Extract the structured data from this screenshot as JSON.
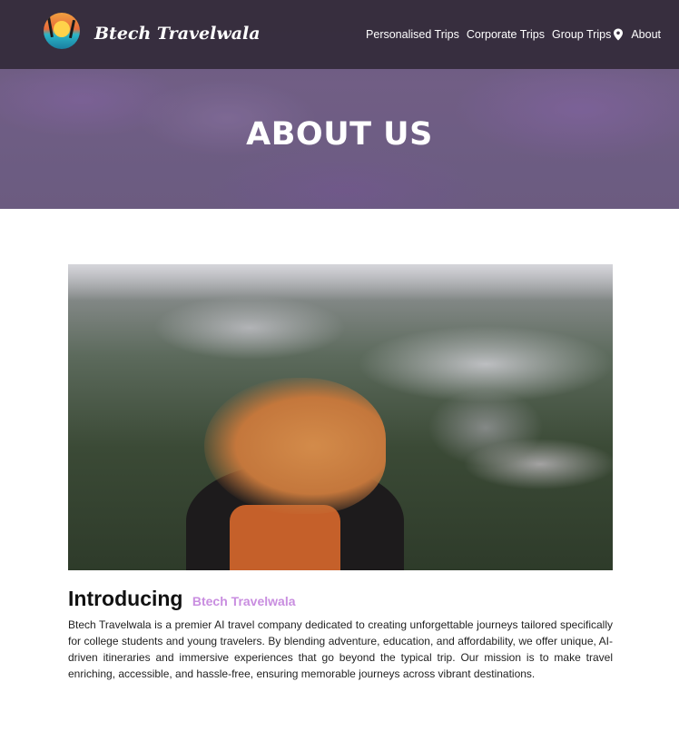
{
  "nav": {
    "brand": "Btech Travelwala",
    "links": [
      {
        "label": "Personalised Trips"
      },
      {
        "label": "Corporate Trips"
      },
      {
        "label": "Group Trips"
      },
      {
        "label": "About"
      }
    ],
    "icons": {
      "location": "location-pin-icon",
      "logo": "beach-sunset-logo"
    }
  },
  "hero": {
    "title": "ABOUT US"
  },
  "intro": {
    "heading": "Introducing",
    "brand_accent": "Btech Travelwala",
    "paragraph": "Btech Travelwala is a premier AI travel company dedicated to creating unforgettable journeys tailored specifically for college students and young travelers. By blending adventure, education, and affordability, we offer unique, AI-driven itineraries and immersive experiences that go beyond the typical trip. Our mission is to make travel enriching, accessible, and hassle-free, ensuring memorable journeys across vibrant destinations."
  },
  "colors": {
    "accent": "#c98ee0",
    "nav_bg": "#302836",
    "hero_tint": "#7a6692"
  }
}
